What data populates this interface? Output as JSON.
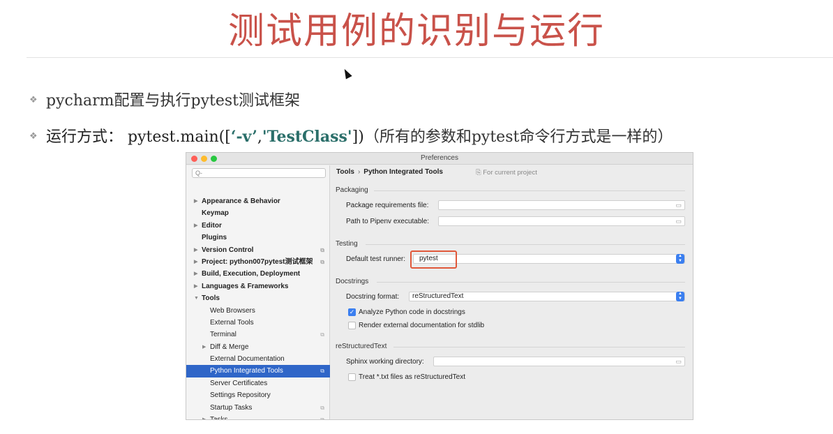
{
  "slide": {
    "title": "测试用例的识别与运行",
    "bullet1": "pycharm配置与执行pytest测试框架",
    "bullet2_prefix": "运行方式：  pytest.main([",
    "bullet2_arg1": "‘-v’",
    "bullet2_comma": ",",
    "bullet2_arg2": "'TestClass'",
    "bullet2_close": "])",
    "bullet2_note": "（所有的参数和pytest命令行方式是一样的）"
  },
  "window": {
    "title": "Preferences"
  },
  "sidebar": {
    "search_placeholder": "Q-",
    "items": [
      {
        "label": "Appearance & Behavior",
        "level": 0,
        "bold": true,
        "arrow": "▶"
      },
      {
        "label": "Keymap",
        "level": 0,
        "bold": true,
        "arrow": ""
      },
      {
        "label": "Editor",
        "level": 0,
        "bold": true,
        "arrow": "▶"
      },
      {
        "label": "Plugins",
        "level": 0,
        "bold": true,
        "arrow": ""
      },
      {
        "label": "Version Control",
        "level": 0,
        "bold": true,
        "arrow": "▶",
        "copy": true
      },
      {
        "label": "Project: python007pytest测试框架",
        "level": 0,
        "bold": true,
        "arrow": "▶",
        "copy": true
      },
      {
        "label": "Build, Execution, Deployment",
        "level": 0,
        "bold": true,
        "arrow": "▶"
      },
      {
        "label": "Languages & Frameworks",
        "level": 0,
        "bold": true,
        "arrow": "▶"
      },
      {
        "label": "Tools",
        "level": 0,
        "bold": true,
        "arrow": "▼"
      },
      {
        "label": "Web Browsers",
        "level": 1,
        "arrow": ""
      },
      {
        "label": "External Tools",
        "level": 1,
        "arrow": ""
      },
      {
        "label": "Terminal",
        "level": 1,
        "arrow": "",
        "copy": true
      },
      {
        "label": "Diff & Merge",
        "level": 1,
        "arrow": "▶"
      },
      {
        "label": "External Documentation",
        "level": 1,
        "arrow": ""
      },
      {
        "label": "Python Integrated Tools",
        "level": 1,
        "arrow": "",
        "copy": true,
        "selected": true
      },
      {
        "label": "Server Certificates",
        "level": 1,
        "arrow": ""
      },
      {
        "label": "Settings Repository",
        "level": 1,
        "arrow": ""
      },
      {
        "label": "Startup Tasks",
        "level": 1,
        "arrow": "",
        "copy": true
      },
      {
        "label": "Tasks",
        "level": 1,
        "arrow": "▶",
        "copy": true
      }
    ]
  },
  "content": {
    "breadcrumb_root": "Tools",
    "breadcrumb_sep": "›",
    "breadcrumb_leaf": "Python Integrated Tools",
    "scope": "⎘ For current project",
    "packaging": {
      "heading": "Packaging",
      "requirements_label": "Package requirements file:",
      "requirements_value": "",
      "pipenv_label": "Path to Pipenv executable:",
      "pipenv_value": ""
    },
    "testing": {
      "heading": "Testing",
      "runner_label": "Default test runner:",
      "runner_value": "pytest"
    },
    "docstrings": {
      "heading": "Docstrings",
      "format_label": "Docstring format:",
      "format_value": "reStructuredText",
      "analyze_label": "Analyze Python code in docstrings",
      "analyze_checked": true,
      "render_label": "Render external documentation for stdlib",
      "render_checked": false
    },
    "rst": {
      "heading": "reStructuredText",
      "sphinx_label": "Sphinx working directory:",
      "sphinx_value": "",
      "treat_label": "Treat *.txt files as reStructuredText",
      "treat_checked": false
    }
  },
  "icons": {
    "folder": "folder-icon",
    "copy": "copy-icon",
    "dropdown": "dropdown-arrows-icon",
    "check": "checkmark-icon"
  },
  "colors": {
    "title": "#c9524a",
    "selection": "#2f66c8",
    "highlight_box": "#e0583a",
    "accent": "#3b7ff0"
  }
}
